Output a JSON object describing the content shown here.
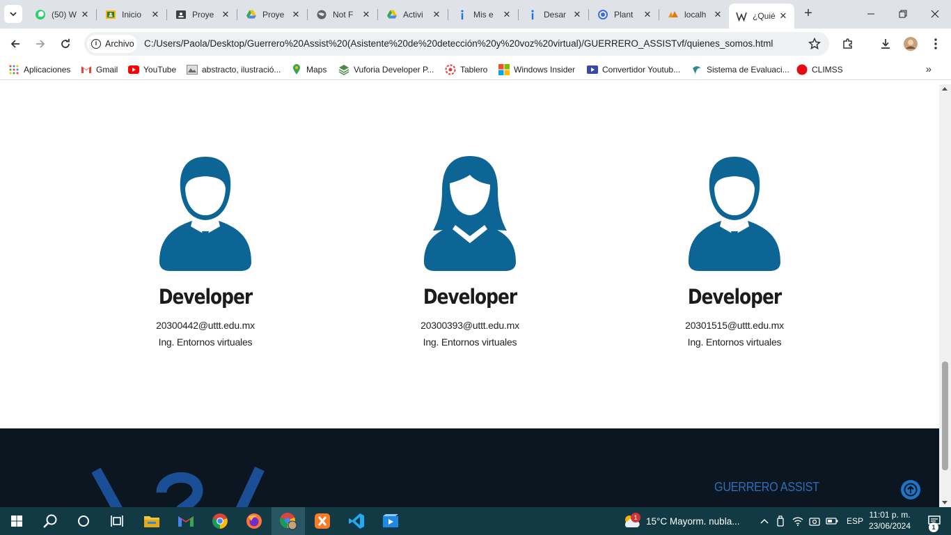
{
  "browser": {
    "tabs": [
      {
        "title": "(50) W",
        "icon": "whatsapp-icon"
      },
      {
        "title": "Inicio",
        "icon": "classroom-icon"
      },
      {
        "title": "Proye",
        "icon": "contact-card-icon"
      },
      {
        "title": "Proye",
        "icon": "google-drive-icon"
      },
      {
        "title": "Not F",
        "icon": "globe-icon"
      },
      {
        "title": "Activi",
        "icon": "google-drive-icon"
      },
      {
        "title": "Mis e",
        "icon": "info-icon"
      },
      {
        "title": "Desar",
        "icon": "info-icon"
      },
      {
        "title": "Plant",
        "icon": "canva-icon"
      },
      {
        "title": "localh",
        "icon": "phpmyadmin-icon"
      },
      {
        "title": "¿Quié",
        "icon": "wordpress-icon",
        "active": true
      }
    ],
    "chip_label": "Archivo",
    "url": "C:/Users/Paola/Desktop/Guerrero%20Assist%20(Asistente%20de%20detección%20y%20voz%20virtual)/GUERRERO_ASSISTvf/quienes_somos.html",
    "bookmarks": [
      {
        "label": "Aplicaciones",
        "icon": "apps-grid-icon"
      },
      {
        "label": "Gmail",
        "icon": "gmail-icon"
      },
      {
        "label": "YouTube",
        "icon": "youtube-icon"
      },
      {
        "label": "abstracto, ilustració...",
        "icon": "image-icon"
      },
      {
        "label": "Maps",
        "icon": "maps-pin-icon"
      },
      {
        "label": "Vuforia Developer P...",
        "icon": "vuforia-icon"
      },
      {
        "label": "Tablero",
        "icon": "tablero-icon"
      },
      {
        "label": "Windows Insider",
        "icon": "windows-logo-icon"
      },
      {
        "label": "Convertidor Youtub...",
        "icon": "converter-icon"
      },
      {
        "label": "Sistema de Evaluaci...",
        "icon": "evaluation-icon"
      },
      {
        "label": "CLIMSS",
        "icon": "red-dot-icon"
      }
    ]
  },
  "team": [
    {
      "role": "Developer",
      "email": "20300442@uttt.edu.mx",
      "career": "Ing. Entornos virtuales",
      "avatar": "male-user-icon"
    },
    {
      "role": "Developer",
      "email": "20300393@uttt.edu.mx",
      "career": "Ing. Entornos virtuales",
      "avatar": "female-user-icon"
    },
    {
      "role": "Developer",
      "email": "20301515@uttt.edu.mx",
      "career": "Ing. Entornos virtuales",
      "avatar": "male-user-icon"
    }
  ],
  "footer": {
    "brand": "GUERRERO ASSIST"
  },
  "colors": {
    "avatar": "#0d6596",
    "footer_bg": "#0c1621",
    "brand": "#2a6fb8",
    "taskbar": "#113a45"
  },
  "taskbar": {
    "weather": "15°C  Mayorm. nubla...",
    "language": "ESP",
    "time": "11:01 p. m.",
    "date": "23/06/2024",
    "notification_count": "1",
    "weather_badge": "1"
  }
}
